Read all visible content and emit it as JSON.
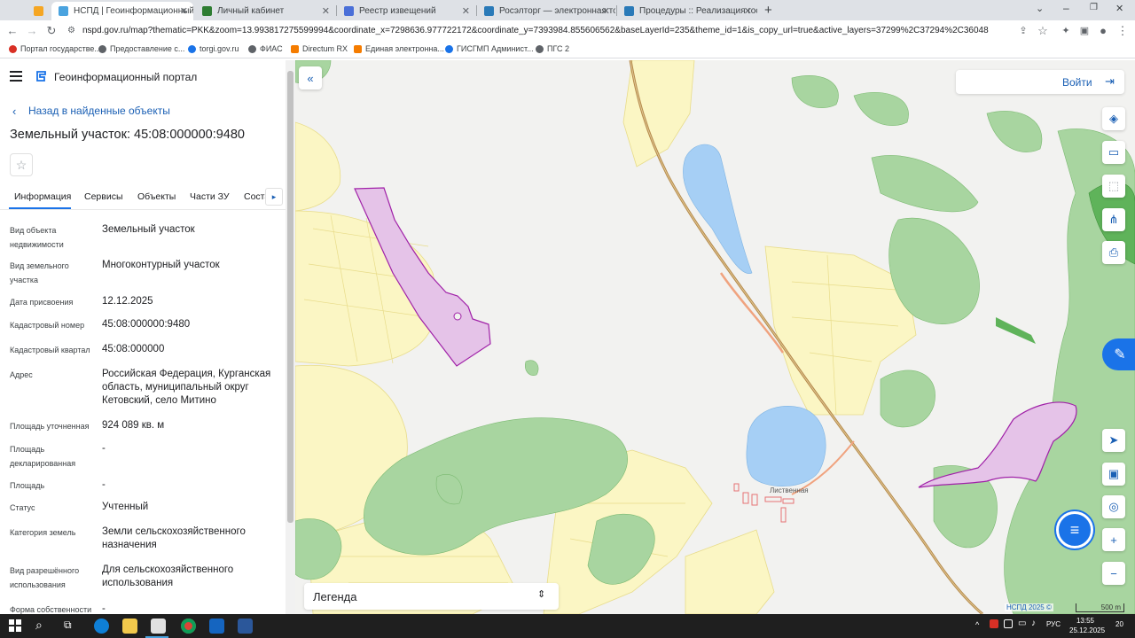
{
  "browser": {
    "tabs": [
      {
        "title": "",
        "color": "#f5a623"
      },
      {
        "title": "НСПД | Геоинформационный п",
        "color": "#4aa3df"
      },
      {
        "title": "Личный кабинет",
        "color": "#2e7d32"
      },
      {
        "title": "Реестр извещений",
        "color": "#4a6fd8"
      },
      {
        "title": "Росэлторг — электронная торг",
        "color": "#2a7ab8"
      },
      {
        "title": "Процедуры :: Реализация госим",
        "color": "#2a7ab8"
      }
    ],
    "url": "nspd.gov.ru/map?thematic=PKK&zoom=13.993817275599994&coordinate_x=7298636.977722172&coordinate_y=7393984.855606562&baseLayerId=235&theme_id=1&is_copy_url=true&active_layers=37299%2C37294%2C36048",
    "bookmarks": [
      {
        "label": "Портал государстве...",
        "color": "#d93025"
      },
      {
        "label": "Предоставление с...",
        "color": "#5f6368"
      },
      {
        "label": "torgi.gov.ru",
        "color": "#1a73e8"
      },
      {
        "label": "ФИАС",
        "color": "#5f6368"
      },
      {
        "label": "Directum RX",
        "color": "#f57c00"
      },
      {
        "label": "Единая электронна...",
        "color": "#f57c00"
      },
      {
        "label": "ГИСГМП Админист...",
        "color": "#1a73e8"
      },
      {
        "label": "ПГС 2",
        "color": "#5f6368"
      }
    ]
  },
  "app": {
    "title": "Геоинформационный портал",
    "back_link": "Назад в найденные объекты",
    "object_title": "Земельный участок: 45:08:000000:9480",
    "tabs": [
      "Информация",
      "Сервисы",
      "Объекты",
      "Части ЗУ",
      "Соста"
    ],
    "fields": [
      {
        "label": "Вид объекта недвижимости",
        "value": "Земельный участок"
      },
      {
        "label": "Вид земельного участка",
        "value": "Многоконтурный участок"
      },
      {
        "label": "Дата присвоения",
        "value": "12.12.2025"
      },
      {
        "label": "Кадастровый номер",
        "value": "45:08:000000:9480"
      },
      {
        "label": "Кадастровый квартал",
        "value": "45:08:000000"
      },
      {
        "label": "Адрес",
        "value": "Российская Федерация, Курганская область, муниципальный округ Кетовский, село Митино"
      },
      {
        "label": "Площадь уточненная",
        "value": "924 089 кв. м"
      },
      {
        "label": "Площадь декларированная",
        "value": "-"
      },
      {
        "label": "Площадь",
        "value": "-"
      },
      {
        "label": "Статус",
        "value": "Учтенный"
      },
      {
        "label": "Категория земель",
        "value": "Земли сельскохозяйственного назначения"
      },
      {
        "label": "Вид разрешённого использования",
        "value": "Для сельскохозяйственного использования"
      },
      {
        "label": "Форма собственности",
        "value": "-"
      }
    ]
  },
  "map": {
    "login_label": "Войти",
    "legend_label": "Легенда",
    "place_label": "Лиственная",
    "copyright": "НСПД 2025 ©",
    "scale": "500 m",
    "colors": {
      "forest": "#a8d5a0",
      "field": "#fbf6c4",
      "water": "#a6cff5",
      "parcel": "#e5c3e8",
      "parcel_border": "#a021a8",
      "rail": "#b5894a",
      "road": "#f0a37f"
    }
  },
  "taskbar": {
    "lang": "РУС",
    "time": "13:55",
    "date": "25.12.2025",
    "notifications": "20"
  }
}
